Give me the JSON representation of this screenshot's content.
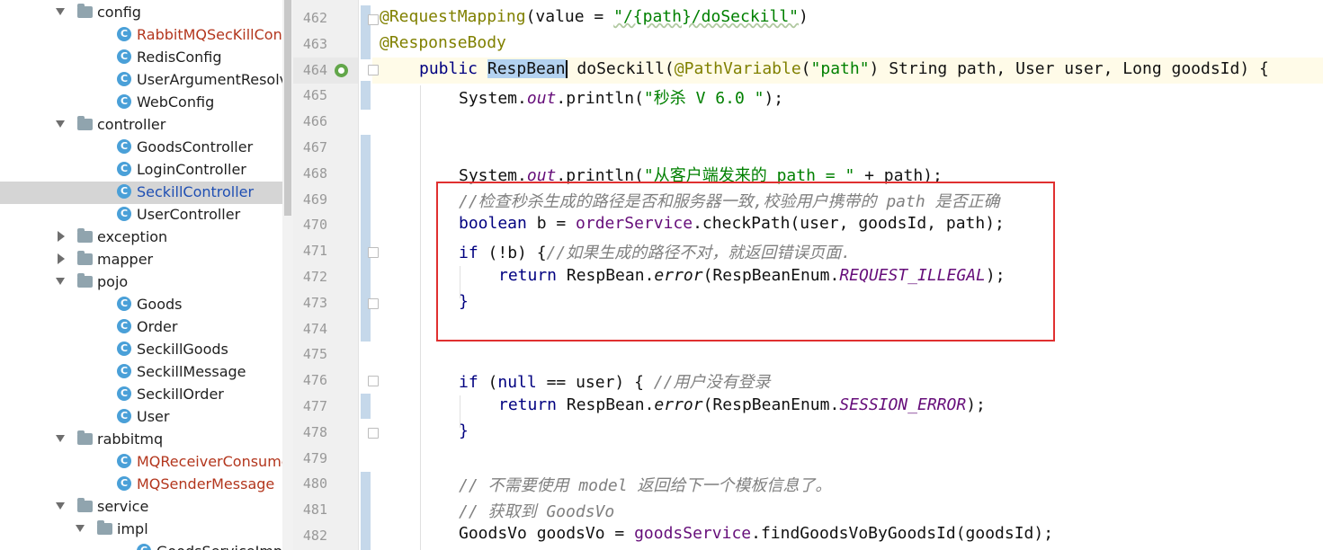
{
  "tree": {
    "items": [
      {
        "label": "config",
        "kind": "folder",
        "state": "open",
        "depth": 0
      },
      {
        "label": "RabbitMQSecKillConfig",
        "kind": "class",
        "color": "red",
        "depth": 1
      },
      {
        "label": "RedisConfig",
        "kind": "class",
        "depth": 1
      },
      {
        "label": "UserArgumentResolver",
        "kind": "class",
        "depth": 1
      },
      {
        "label": "WebConfig",
        "kind": "class",
        "depth": 1
      },
      {
        "label": "controller",
        "kind": "folder",
        "state": "open",
        "depth": 0
      },
      {
        "label": "GoodsController",
        "kind": "class",
        "depth": 1
      },
      {
        "label": "LoginController",
        "kind": "class",
        "depth": 1
      },
      {
        "label": "SeckillController",
        "kind": "class",
        "color": "blue",
        "selected": true,
        "depth": 1
      },
      {
        "label": "UserController",
        "kind": "class",
        "depth": 1
      },
      {
        "label": "exception",
        "kind": "folder",
        "state": "closed",
        "depth": 0
      },
      {
        "label": "mapper",
        "kind": "folder",
        "state": "closed",
        "depth": 0
      },
      {
        "label": "pojo",
        "kind": "folder",
        "state": "open",
        "depth": 0
      },
      {
        "label": "Goods",
        "kind": "class",
        "depth": 1
      },
      {
        "label": "Order",
        "kind": "class",
        "depth": 1
      },
      {
        "label": "SeckillGoods",
        "kind": "class",
        "depth": 1
      },
      {
        "label": "SeckillMessage",
        "kind": "class",
        "depth": 1
      },
      {
        "label": "SeckillOrder",
        "kind": "class",
        "depth": 1
      },
      {
        "label": "User",
        "kind": "class",
        "depth": 1
      },
      {
        "label": "rabbitmq",
        "kind": "folder",
        "state": "open",
        "depth": 0
      },
      {
        "label": "MQReceiverConsumer",
        "kind": "class",
        "color": "red",
        "depth": 1
      },
      {
        "label": "MQSenderMessage",
        "kind": "class",
        "color": "red",
        "depth": 1
      },
      {
        "label": "service",
        "kind": "folder",
        "state": "open",
        "depth": 0
      },
      {
        "label": "impl",
        "kind": "folder",
        "state": "open",
        "depth": 1
      },
      {
        "label": "GoodsServiceImpl",
        "kind": "class",
        "depth": 2
      }
    ],
    "class_icon_glyph": "C"
  },
  "editor": {
    "line_numbers": [
      "462",
      "463",
      "464",
      "465",
      "466",
      "467",
      "468",
      "469",
      "470",
      "471",
      "472",
      "473",
      "474",
      "475",
      "476",
      "477",
      "478",
      "479",
      "480",
      "481",
      "482"
    ],
    "current_line": "464",
    "lines": {
      "l462": {
        "a": "@RequestMapping",
        "b": "(value = ",
        "c": "\"/{path}/doSeckill\"",
        "d": ")"
      },
      "l463": {
        "a": "@ResponseBody"
      },
      "l464": {
        "kw": "public ",
        "type": "RespBean",
        "name": " doSeckill(",
        "ann": "@PathVariable",
        "p1": "(",
        "s": "\"path\"",
        "rest": ") String path, User user, Long goodsId) {"
      },
      "l465": {
        "a": "System.",
        "b": "out",
        "c": ".println(",
        "d": "\"秒杀 V 6.0 \"",
        "e": ");"
      },
      "l468": {
        "a": "System.",
        "b": "out",
        "c": ".println(",
        "d": "\"从客户端发来的 path = \"",
        "e": " + path);"
      },
      "l469": {
        "cmt": "//检查秒杀生成的路径是否和服务器一致,校验用户携带的 path 是否正确"
      },
      "l470": {
        "kw": "boolean",
        "a": " b = ",
        "f": "orderService",
        "b": ".checkPath(user, goodsId, path);"
      },
      "l471": {
        "kw": "if",
        "a": " (!b) {",
        "cmt": "//如果生成的路径不对，就返回错误页面."
      },
      "l472": {
        "kw": "return",
        "a": " RespBean.",
        "m": "error",
        "b": "(RespBeanEnum.",
        "c": "REQUEST_ILLEGAL",
        "d": ");"
      },
      "l473": {
        "a": "}"
      },
      "l476": {
        "kw": "if",
        "a": " (",
        "kw2": "null",
        "b": " == user) { ",
        "cmt": "//用户没有登录"
      },
      "l477": {
        "kw": "return",
        "a": " RespBean.",
        "m": "error",
        "b": "(RespBeanEnum.",
        "c": "SESSION_ERROR",
        "d": ");"
      },
      "l478": {
        "a": "}"
      },
      "l480": {
        "cmt": "// 不需要使用 model 返回给下一个模板信息了。"
      },
      "l481": {
        "cmt": "// 获取到 GoodsVo"
      },
      "l482": {
        "a": "GoodsVo goodsVo = ",
        "f": "goodsService",
        "b": ".findGoodsVoByGoodsId(goodsId);"
      }
    }
  },
  "colors": {
    "keyword": "#000080",
    "annotation": "#808000",
    "string": "#008000",
    "field": "#660e7a",
    "comment": "#808080",
    "highlight_box": "#e03030"
  }
}
